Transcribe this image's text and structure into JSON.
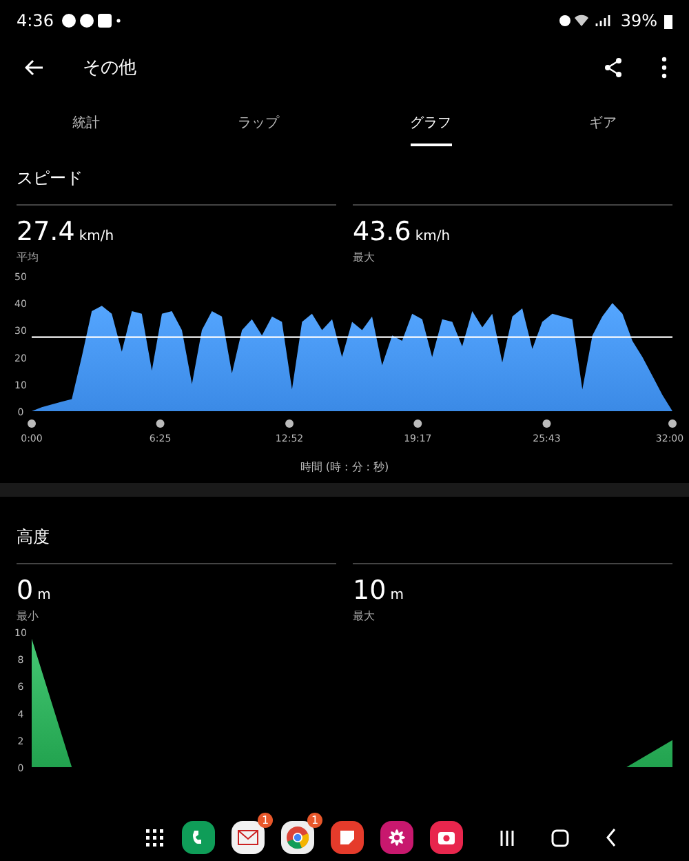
{
  "status_bar": {
    "time": "4:36",
    "battery": "39%"
  },
  "header": {
    "title": "その他"
  },
  "tabs": [
    {
      "label": "統計",
      "selected": false
    },
    {
      "label": "ラップ",
      "selected": false
    },
    {
      "label": "グラフ",
      "selected": true
    },
    {
      "label": "ギア",
      "selected": false
    }
  ],
  "sections": [
    {
      "title": "スピード",
      "stats": [
        {
          "value": "27.4",
          "unit": "km/h",
          "label": "平均"
        },
        {
          "value": "43.6",
          "unit": "km/h",
          "label": "最大"
        }
      ],
      "chart_data": {
        "type": "area",
        "xlabel": "時間 (時 : 分 : 秒)",
        "x": [
          0,
          0.5,
          1,
          1.5,
          2,
          2.5,
          3,
          3.5,
          4,
          4.5,
          5,
          5.5,
          6,
          6.5,
          7,
          7.5,
          8,
          8.5,
          9,
          9.5,
          10,
          10.5,
          11,
          11.5,
          12,
          12.5,
          13,
          13.5,
          14,
          14.5,
          15,
          15.5,
          16,
          16.5,
          17,
          17.5,
          18,
          18.5,
          19,
          19.5,
          20,
          20.5,
          21,
          21.5,
          22,
          22.5,
          23,
          23.5,
          24,
          24.5,
          25,
          25.5,
          26,
          26.5,
          27,
          27.5,
          28,
          28.5,
          29,
          29.5,
          30,
          30.5,
          31,
          31.5,
          32
        ],
        "series": [
          {
            "color": "#3b8ae6",
            "values": [
              0,
              1.5,
              2.5,
              3.5,
              4.5,
              20,
              37,
              39,
              36,
              22,
              37,
              36,
              15,
              36,
              37,
              30,
              10,
              30,
              37,
              35,
              14,
              30,
              34,
              28,
              35,
              33,
              8,
              33,
              36,
              30,
              34,
              20,
              33,
              30,
              35,
              17,
              28,
              26,
              36,
              34,
              20,
              34,
              33,
              24,
              37,
              31,
              36,
              18,
              35,
              38,
              23,
              33,
              36,
              35,
              34,
              8,
              28,
              35,
              40,
              36,
              26,
              20,
              13,
              6,
              0
            ]
          }
        ],
        "xlim": [
          0,
          32
        ],
        "ylim": [
          0,
          50
        ],
        "xticks": [
          {
            "value": 0,
            "label": "0:00"
          },
          {
            "value": 6.42,
            "label": "6:25"
          },
          {
            "value": 12.87,
            "label": "12:52"
          },
          {
            "value": 19.28,
            "label": "19:17"
          },
          {
            "value": 25.72,
            "label": "25:43"
          },
          {
            "value": 32,
            "label": "32:00"
          }
        ],
        "yticks": [
          0,
          10,
          20,
          30,
          40,
          50
        ],
        "ref_lines": [
          {
            "axis": "y",
            "value": 27.4
          }
        ]
      }
    },
    {
      "title": "高度",
      "stats": [
        {
          "value": "0",
          "unit": "m",
          "label": "最小"
        },
        {
          "value": "10",
          "unit": "m",
          "label": "最大"
        }
      ],
      "chart_data": {
        "type": "area",
        "x": [
          0,
          2,
          29.7,
          32
        ],
        "series": [
          {
            "color": "#22a34f",
            "values": [
              9.5,
              0,
              0,
              2
            ]
          }
        ],
        "xlim": [
          0,
          32
        ],
        "ylim": [
          0,
          10
        ],
        "yticks": [
          0,
          2,
          4,
          6,
          8,
          10
        ]
      }
    }
  ],
  "dock": [
    {
      "kind": "apps"
    },
    {
      "kind": "phone"
    },
    {
      "kind": "mail",
      "badge": "1"
    },
    {
      "kind": "browser",
      "badge": "1"
    },
    {
      "kind": "notes"
    },
    {
      "kind": "flower"
    },
    {
      "kind": "camera"
    }
  ],
  "nav": [
    {
      "kind": "recents"
    },
    {
      "kind": "home"
    },
    {
      "kind": "back"
    }
  ]
}
